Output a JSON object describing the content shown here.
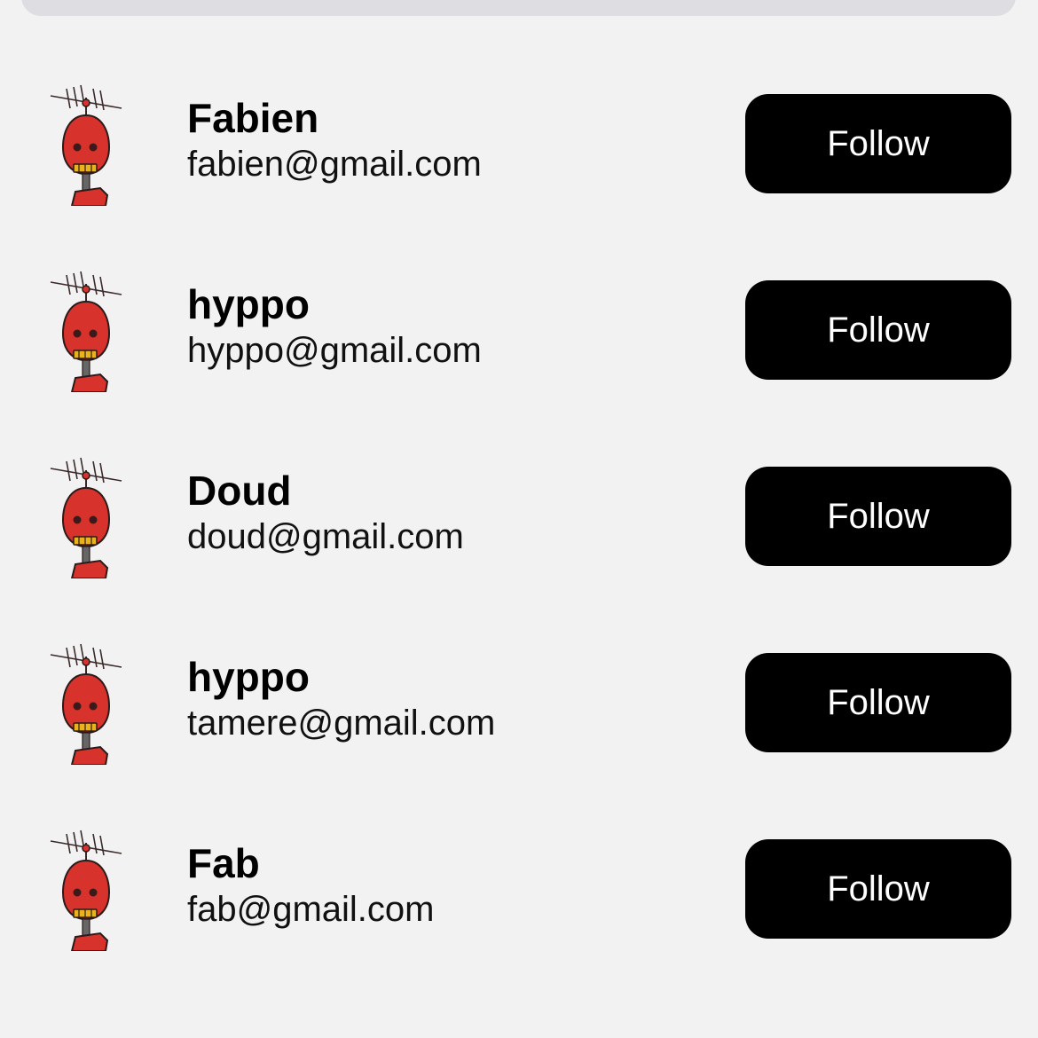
{
  "search": {},
  "users": [
    {
      "name": "Fabien",
      "email": "fabien@gmail.com",
      "button_label": "Follow",
      "avatar_icon": "robot-avatar-icon"
    },
    {
      "name": "hyppo",
      "email": "hyppo@gmail.com",
      "button_label": "Follow",
      "avatar_icon": "robot-avatar-icon"
    },
    {
      "name": "Doud",
      "email": "doud@gmail.com",
      "button_label": "Follow",
      "avatar_icon": "robot-avatar-icon"
    },
    {
      "name": "hyppo",
      "email": "tamere@gmail.com",
      "button_label": "Follow",
      "avatar_icon": "robot-avatar-icon"
    },
    {
      "name": "Fab",
      "email": "fab@gmail.com",
      "button_label": "Follow",
      "avatar_icon": "robot-avatar-icon"
    }
  ],
  "colors": {
    "background": "#f2f2f2",
    "button_bg": "#000000",
    "button_text": "#ffffff",
    "avatar_red": "#d8322c"
  }
}
